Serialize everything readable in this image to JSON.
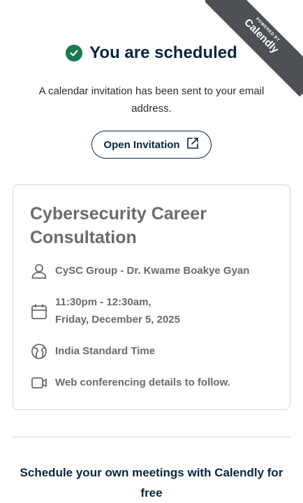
{
  "ribbon": {
    "powered_by": "POWERED BY",
    "brand": "Calendly"
  },
  "confirmation": {
    "title": "You are scheduled",
    "subtitle": "A calendar invitation has been sent to your email address."
  },
  "invite_button": {
    "label": "Open Invitation"
  },
  "event": {
    "name": "Cybersecurity Career Consultation",
    "host": "CySC Group - Dr. Kwame Boakye Gyan",
    "time_line1": "11:30pm - 12:30am,",
    "time_line2": "Friday, December 5, 2025",
    "timezone": "India Standard Time",
    "location": "Web conferencing details to follow."
  },
  "promo": {
    "text": "Schedule your own meetings with Calendly for free"
  },
  "colors": {
    "success": "#1a7a4c",
    "navy": "#0a2540",
    "muted": "#6b6b6b",
    "ribbon": "#4d5055"
  }
}
